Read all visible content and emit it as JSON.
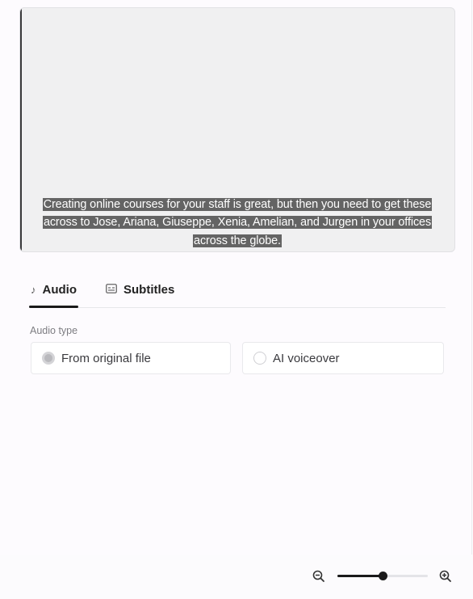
{
  "video": {
    "caption_lines": [
      "Creating online courses for your staff is great, but then you need to get these",
      "across to Jose, Ariana, Giuseppe, Xenia, Amelian, and Jurgen in your offices",
      "across the globe."
    ]
  },
  "tabs": [
    {
      "label": "Audio",
      "icon": "music-note-icon",
      "active": true
    },
    {
      "label": "Subtitles",
      "icon": "subtitles-icon",
      "active": false
    }
  ],
  "audio_type": {
    "label": "Audio type",
    "options": [
      {
        "label": "From original file",
        "selected": true
      },
      {
        "label": "AI voiceover",
        "selected": false
      }
    ]
  },
  "zoom": {
    "level_fraction": 0.5,
    "zoom_out_icon": "zoom-out-icon",
    "zoom_in_icon": "zoom-in-icon"
  },
  "colors": {
    "accent": "#1a1a1a",
    "caption_bg": "#585858"
  }
}
